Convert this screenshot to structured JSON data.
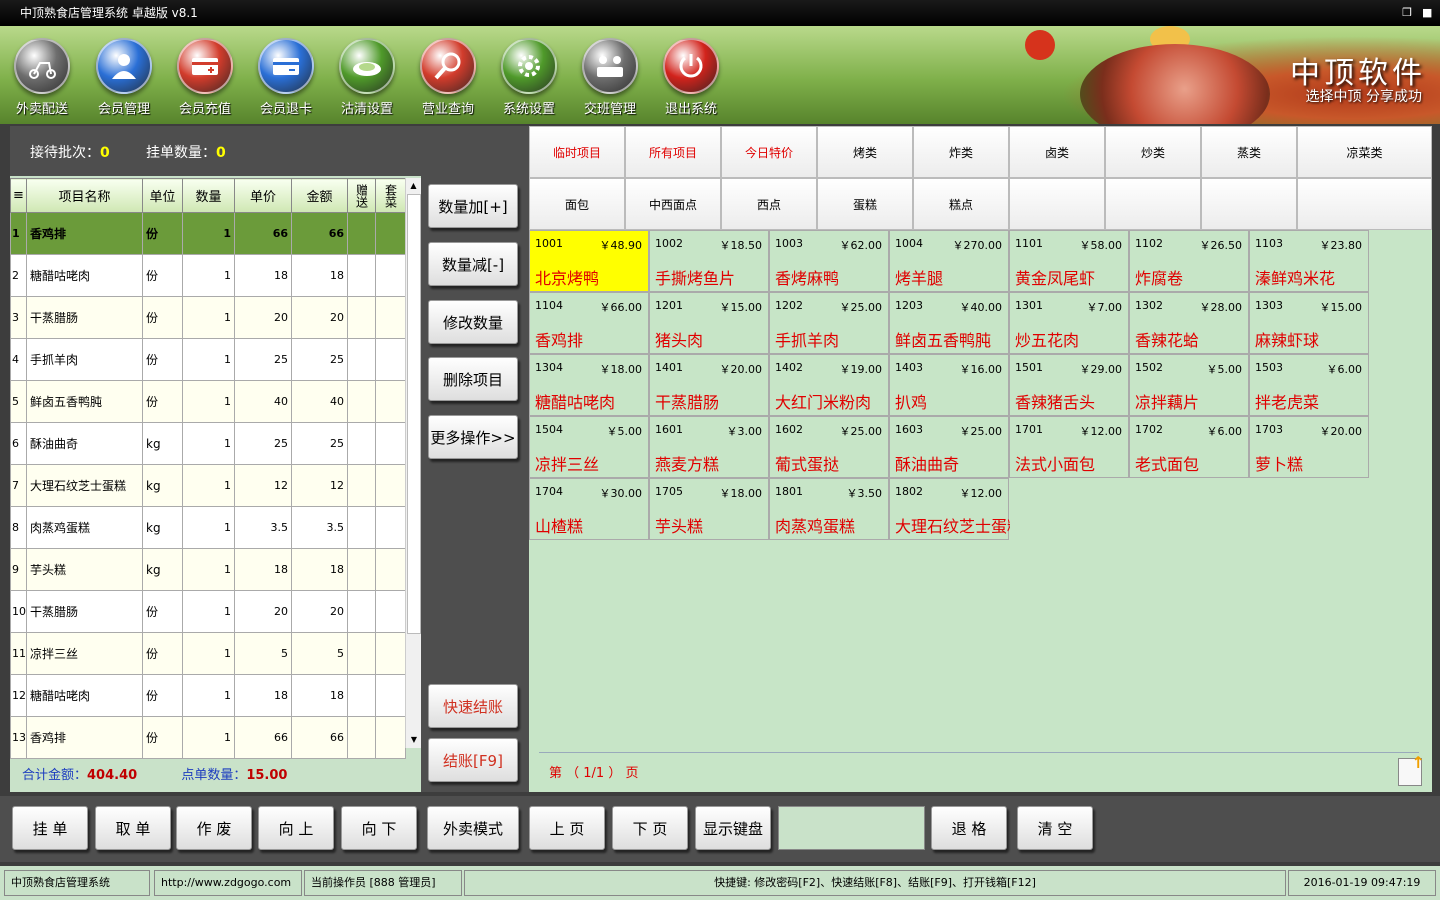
{
  "window": {
    "title": "中顶熟食店管理系统 卓越版 v8.1",
    "restore_icon": "restore-icon",
    "close_icon": "close-icon"
  },
  "toolbar": [
    {
      "label": "外卖配送",
      "icon": "scooter-icon",
      "color": "#6e6e6e"
    },
    {
      "label": "会员管理",
      "icon": "user-icon",
      "color": "#2a6fd6"
    },
    {
      "label": "会员充值",
      "icon": "card-plus-icon",
      "color": "#d23c2c"
    },
    {
      "label": "会员退卡",
      "icon": "card-minus-icon",
      "color": "#2a6fd6"
    },
    {
      "label": "沽清设置",
      "icon": "plate-icon",
      "color": "#4f9a2a"
    },
    {
      "label": "营业查询",
      "icon": "search-icon",
      "color": "#d23c2c"
    },
    {
      "label": "系统设置",
      "icon": "gear-icon",
      "color": "#4f9a2a"
    },
    {
      "label": "交班管理",
      "icon": "team-icon",
      "color": "#6e6e6e"
    },
    {
      "label": "退出系统",
      "icon": "power-icon",
      "color": "#d2231c"
    }
  ],
  "brand": {
    "title": "中顶软件",
    "subtitle": "选择中顶 分享成功"
  },
  "order": {
    "batch_label": "接待批次：",
    "batch_value": "0",
    "hold_label": "挂单数量：",
    "hold_value": "0",
    "headers": [
      "",
      "项目名称",
      "单位",
      "数量",
      "单价",
      "金额",
      "赠送",
      "套菜"
    ],
    "rows": [
      {
        "no": "1",
        "name": "香鸡排",
        "unit": "份",
        "qty": "1",
        "price": "66",
        "amount": "66"
      },
      {
        "no": "2",
        "name": "糖醋咕咾肉",
        "unit": "份",
        "qty": "1",
        "price": "18",
        "amount": "18"
      },
      {
        "no": "3",
        "name": "干蒸腊肠",
        "unit": "份",
        "qty": "1",
        "price": "20",
        "amount": "20"
      },
      {
        "no": "4",
        "name": "手抓羊肉",
        "unit": "份",
        "qty": "1",
        "price": "25",
        "amount": "25"
      },
      {
        "no": "5",
        "name": "鲜卤五香鸭肫",
        "unit": "份",
        "qty": "1",
        "price": "40",
        "amount": "40"
      },
      {
        "no": "6",
        "name": "酥油曲奇",
        "unit": "kg",
        "qty": "1",
        "price": "25",
        "amount": "25"
      },
      {
        "no": "7",
        "name": "大理石纹芝士蛋糕",
        "unit": "kg",
        "qty": "1",
        "price": "12",
        "amount": "12"
      },
      {
        "no": "8",
        "name": "肉蒸鸡蛋糕",
        "unit": "kg",
        "qty": "1",
        "price": "3.5",
        "amount": "3.5"
      },
      {
        "no": "9",
        "name": "芋头糕",
        "unit": "kg",
        "qty": "1",
        "price": "18",
        "amount": "18"
      },
      {
        "no": "10",
        "name": "干蒸腊肠",
        "unit": "份",
        "qty": "1",
        "price": "20",
        "amount": "20"
      },
      {
        "no": "11",
        "name": "凉拌三丝",
        "unit": "份",
        "qty": "1",
        "price": "5",
        "amount": "5"
      },
      {
        "no": "12",
        "name": "糖醋咕咾肉",
        "unit": "份",
        "qty": "1",
        "price": "18",
        "amount": "18"
      },
      {
        "no": "13",
        "name": "香鸡排",
        "unit": "份",
        "qty": "1",
        "price": "66",
        "amount": "66"
      }
    ],
    "total_label": "合计金额：",
    "total_value": "404.40",
    "count_label": "点单数量：",
    "count_value": "15.00"
  },
  "actions": [
    {
      "label": "数量加[+]",
      "style": "normal"
    },
    {
      "label": "数量减[-]",
      "style": "normal"
    },
    {
      "label": "修改数量",
      "style": "normal"
    },
    {
      "label": "删除项目",
      "style": "normal"
    },
    {
      "label": "更多操作>>",
      "style": "normal"
    },
    {
      "label": "快速结账",
      "style": "red"
    },
    {
      "label": "结账[F9]",
      "style": "red"
    }
  ],
  "categories": [
    [
      "临时项目",
      "所有项目",
      "今日特价",
      "烤类",
      "炸类",
      "卤类",
      "炒类",
      "蒸类",
      "凉菜类"
    ],
    [
      "面包",
      "中西面点",
      "西点",
      "蛋糕",
      "糕点",
      "",
      "",
      "",
      ""
    ]
  ],
  "dishes": [
    {
      "code": "1001",
      "price": "￥48.90",
      "name": "北京烤鸭",
      "selected": true
    },
    {
      "code": "1002",
      "price": "￥18.50",
      "name": "手撕烤鱼片"
    },
    {
      "code": "1003",
      "price": "￥62.00",
      "name": "香烤麻鸭"
    },
    {
      "code": "1004",
      "price": "￥270.00",
      "name": "烤羊腿"
    },
    {
      "code": "1101",
      "price": "￥58.00",
      "name": "黄金凤尾虾"
    },
    {
      "code": "1102",
      "price": "￥26.50",
      "name": "炸腐卷"
    },
    {
      "code": "1103",
      "price": "￥23.80",
      "name": "溱鲜鸡米花"
    },
    {
      "code": "1104",
      "price": "￥66.00",
      "name": "香鸡排"
    },
    {
      "code": "1201",
      "price": "￥15.00",
      "name": "猪头肉"
    },
    {
      "code": "1202",
      "price": "￥25.00",
      "name": "手抓羊肉"
    },
    {
      "code": "1203",
      "price": "￥40.00",
      "name": "鲜卤五香鸭肫"
    },
    {
      "code": "1301",
      "price": "￥7.00",
      "name": "炒五花肉"
    },
    {
      "code": "1302",
      "price": "￥28.00",
      "name": "香辣花蛤"
    },
    {
      "code": "1303",
      "price": "￥15.00",
      "name": "麻辣虾球"
    },
    {
      "code": "1304",
      "price": "￥18.00",
      "name": "糖醋咕咾肉"
    },
    {
      "code": "1401",
      "price": "￥20.00",
      "name": "干蒸腊肠"
    },
    {
      "code": "1402",
      "price": "￥19.00",
      "name": "大红门米粉肉"
    },
    {
      "code": "1403",
      "price": "￥16.00",
      "name": "扒鸡"
    },
    {
      "code": "1501",
      "price": "￥29.00",
      "name": "香辣猪舌头"
    },
    {
      "code": "1502",
      "price": "￥5.00",
      "name": "凉拌藕片"
    },
    {
      "code": "1503",
      "price": "￥6.00",
      "name": "拌老虎菜"
    },
    {
      "code": "1504",
      "price": "￥5.00",
      "name": "凉拌三丝"
    },
    {
      "code": "1601",
      "price": "￥3.00",
      "name": "燕麦方糕"
    },
    {
      "code": "1602",
      "price": "￥25.00",
      "name": "葡式蛋挞"
    },
    {
      "code": "1603",
      "price": "￥25.00",
      "name": "酥油曲奇"
    },
    {
      "code": "1701",
      "price": "￥12.00",
      "name": "法式小面包"
    },
    {
      "code": "1702",
      "price": "￥6.00",
      "name": "老式面包"
    },
    {
      "code": "1703",
      "price": "￥20.00",
      "name": "萝卜糕"
    },
    {
      "code": "1704",
      "price": "￥30.00",
      "name": "山楂糕"
    },
    {
      "code": "1705",
      "price": "￥18.00",
      "name": "芋头糕"
    },
    {
      "code": "1801",
      "price": "￥3.50",
      "name": "肉蒸鸡蛋糕"
    },
    {
      "code": "1802",
      "price": "￥12.00",
      "name": "大理石纹芝士蛋糕"
    }
  ],
  "pager": {
    "text": "第 （ 1/1 ） 页"
  },
  "bottom": [
    "挂 单",
    "取 单",
    "作 废",
    "向 上",
    "向 下",
    "外卖模式",
    "上 页",
    "下 页",
    "显示键盘",
    "退 格",
    "清 空"
  ],
  "keyinput": {
    "value": ""
  },
  "status": {
    "app": "中顶熟食店管理系统",
    "url": "http://www.zdgogo.com",
    "operator": "当前操作员 [888 管理员]",
    "shortcuts": "快捷键:  修改密码[F2]、快速结账[F8]、结账[F9]、打开钱箱[F12]",
    "datetime": "2016-01-19 09:47:19"
  }
}
